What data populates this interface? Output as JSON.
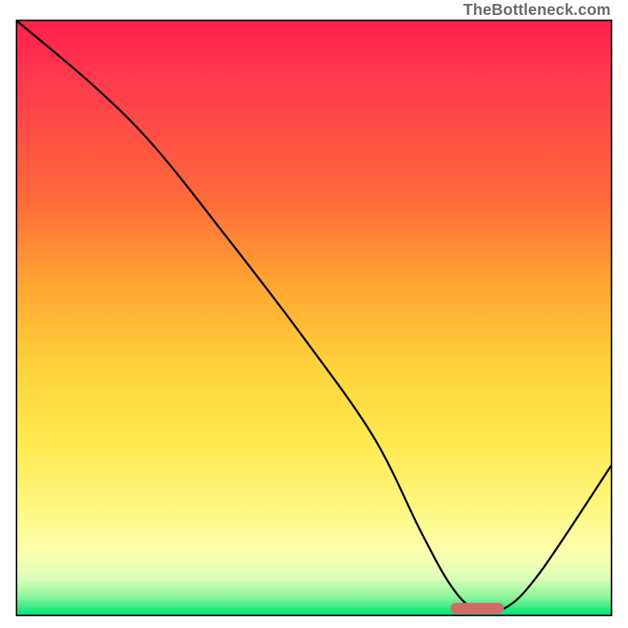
{
  "watermark": "TheBottleneck.com",
  "chart_data": {
    "type": "line",
    "title": "",
    "xlabel": "",
    "ylabel": "",
    "xlim": [
      0,
      100
    ],
    "ylim": [
      0,
      100
    ],
    "grid": false,
    "background": "vertical-gradient red→orange→yellow→green",
    "series": [
      {
        "name": "bottleneck-curve",
        "x": [
          0,
          13,
          23,
          35,
          48,
          60,
          68,
          73,
          77,
          82,
          88,
          100
        ],
        "values": [
          100,
          89,
          79,
          64,
          47,
          30,
          14,
          5,
          1,
          1,
          7,
          25
        ]
      }
    ],
    "optimal_marker": {
      "x_start": 73,
      "x_end": 82,
      "y": 1
    }
  }
}
